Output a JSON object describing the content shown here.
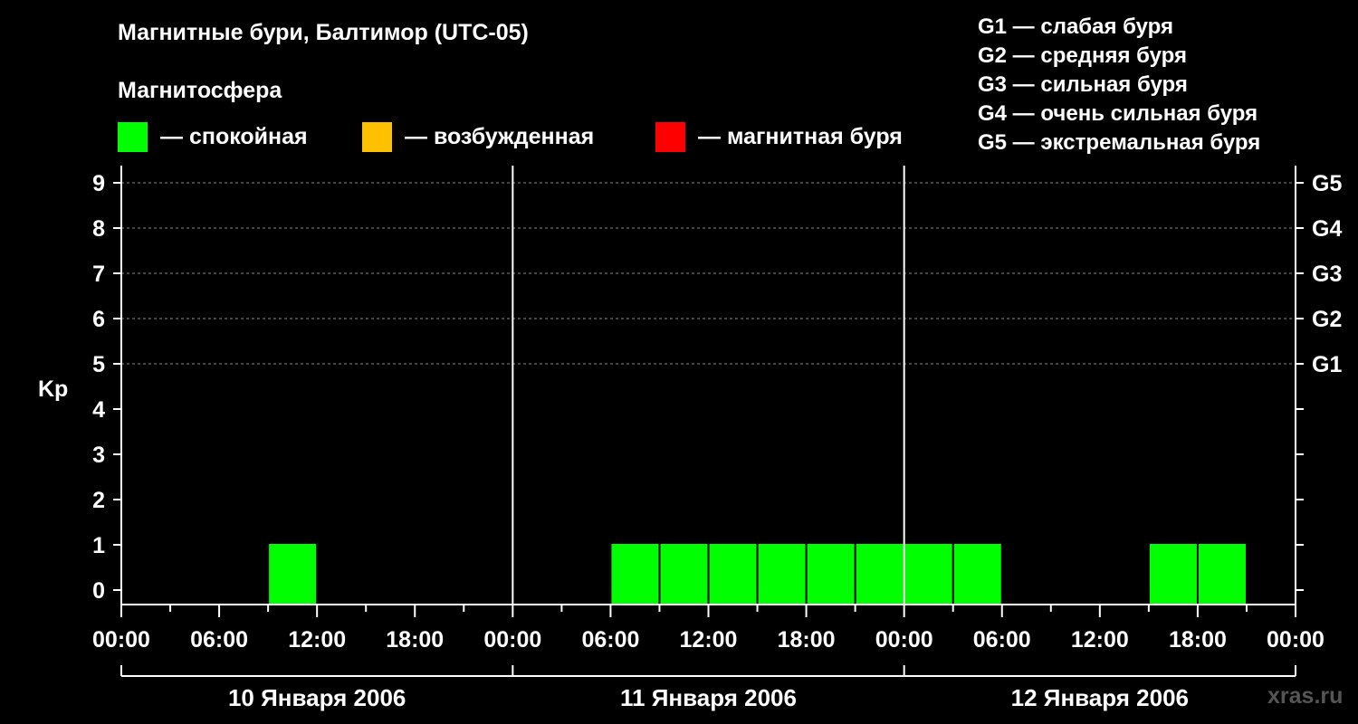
{
  "title": "Магнитные бури, Балтимор (UTC-05)",
  "subtitle": "Магнитосфера",
  "legend": [
    {
      "color": "#00ff00",
      "label": "— спокойная"
    },
    {
      "color": "#ffc000",
      "label": "— возбужденная"
    },
    {
      "color": "#ff0000",
      "label": "— магнитная буря"
    }
  ],
  "storm_scale": [
    "G1 — слабая буря",
    "G2 — средняя буря",
    "G3 — сильная буря",
    "G4 — очень сильная буря",
    "G5 — экстремальная буря"
  ],
  "watermark": "xras.ru",
  "chart_data": {
    "type": "bar",
    "ylabel": "Kp",
    "ylim": [
      0,
      9
    ],
    "y_ticks": [
      "0",
      "1",
      "2",
      "3",
      "4",
      "5",
      "6",
      "7",
      "8",
      "9"
    ],
    "right_axis_labels": [
      {
        "kp": 5,
        "label": "G1"
      },
      {
        "kp": 6,
        "label": "G2"
      },
      {
        "kp": 7,
        "label": "G3"
      },
      {
        "kp": 8,
        "label": "G4"
      },
      {
        "kp": 9,
        "label": "G5"
      }
    ],
    "x_range_hours": [
      0,
      72
    ],
    "x_tick_labels": [
      "00:00",
      "06:00",
      "12:00",
      "18:00",
      "00:00",
      "06:00",
      "12:00",
      "18:00",
      "00:00",
      "06:00",
      "12:00",
      "18:00",
      "00:00"
    ],
    "days": [
      "10 Января 2006",
      "11 Января 2006",
      "12 Января 2006"
    ],
    "bar_width_hours": 3,
    "bars": [
      {
        "start_hour": 9,
        "kp": 1,
        "color": "#00ff00"
      },
      {
        "start_hour": 30,
        "kp": 1,
        "color": "#00ff00"
      },
      {
        "start_hour": 33,
        "kp": 1,
        "color": "#00ff00"
      },
      {
        "start_hour": 36,
        "kp": 1,
        "color": "#00ff00"
      },
      {
        "start_hour": 39,
        "kp": 1,
        "color": "#00ff00"
      },
      {
        "start_hour": 42,
        "kp": 1,
        "color": "#00ff00"
      },
      {
        "start_hour": 45,
        "kp": 1,
        "color": "#00ff00"
      },
      {
        "start_hour": 48,
        "kp": 1,
        "color": "#00ff00"
      },
      {
        "start_hour": 51,
        "kp": 1,
        "color": "#00ff00"
      },
      {
        "start_hour": 63,
        "kp": 1,
        "color": "#00ff00"
      },
      {
        "start_hour": 66,
        "kp": 1,
        "color": "#00ff00"
      }
    ]
  }
}
